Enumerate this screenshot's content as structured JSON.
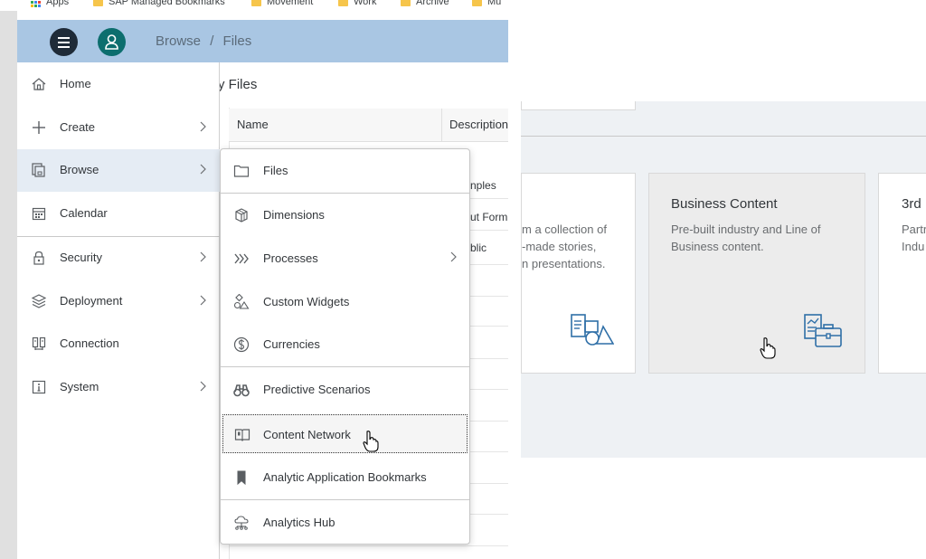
{
  "bookmarks": {
    "apps": "Apps",
    "items": [
      "SAP Managed Bookmarks",
      "Movement",
      "Work",
      "Archive",
      "Mu"
    ]
  },
  "shell": {
    "breadcrumb_root": "Browse",
    "breadcrumb_sep": "/",
    "breadcrumb_current": "Files"
  },
  "files_page": {
    "title_partial": "y Files",
    "col_name": "Name",
    "col_description": "Description",
    "row_fragments": [
      "nples",
      "ut Form",
      "blic"
    ]
  },
  "cards": [
    {
      "title": "",
      "desc_lines": [
        "m a collection of",
        "-made stories,",
        "n presentations."
      ],
      "icon": "stories-shapes-icon"
    },
    {
      "title": "Business Content",
      "desc_lines": [
        "Pre-built industry and Line of",
        "Business content."
      ],
      "icon": "briefcase-report-icon"
    },
    {
      "title": "3rd",
      "desc_lines": [
        "Partr",
        "Indu"
      ],
      "icon": ""
    }
  ],
  "sidenav": {
    "home": "Home",
    "create": "Create",
    "browse": "Browse",
    "calendar": "Calendar",
    "security": "Security",
    "deployment": "Deployment",
    "connection": "Connection",
    "system": "System"
  },
  "submenu": {
    "files": "Files",
    "dimensions": "Dimensions",
    "processes": "Processes",
    "custom_widgets": "Custom Widgets",
    "currencies": "Currencies",
    "predictive_scenarios": "Predictive Scenarios",
    "content_network": "Content Network",
    "analytic_application_bookmarks": "Analytic Application Bookmarks",
    "analytics_hub": "Analytics Hub"
  },
  "colors": {
    "shell_bar": "#a9c6e3",
    "hamburger": "#1f2b38",
    "avatar": "#0d6e6e",
    "nav_selected": "#e5ecf4",
    "icon_blue": "#2f6fa7"
  }
}
